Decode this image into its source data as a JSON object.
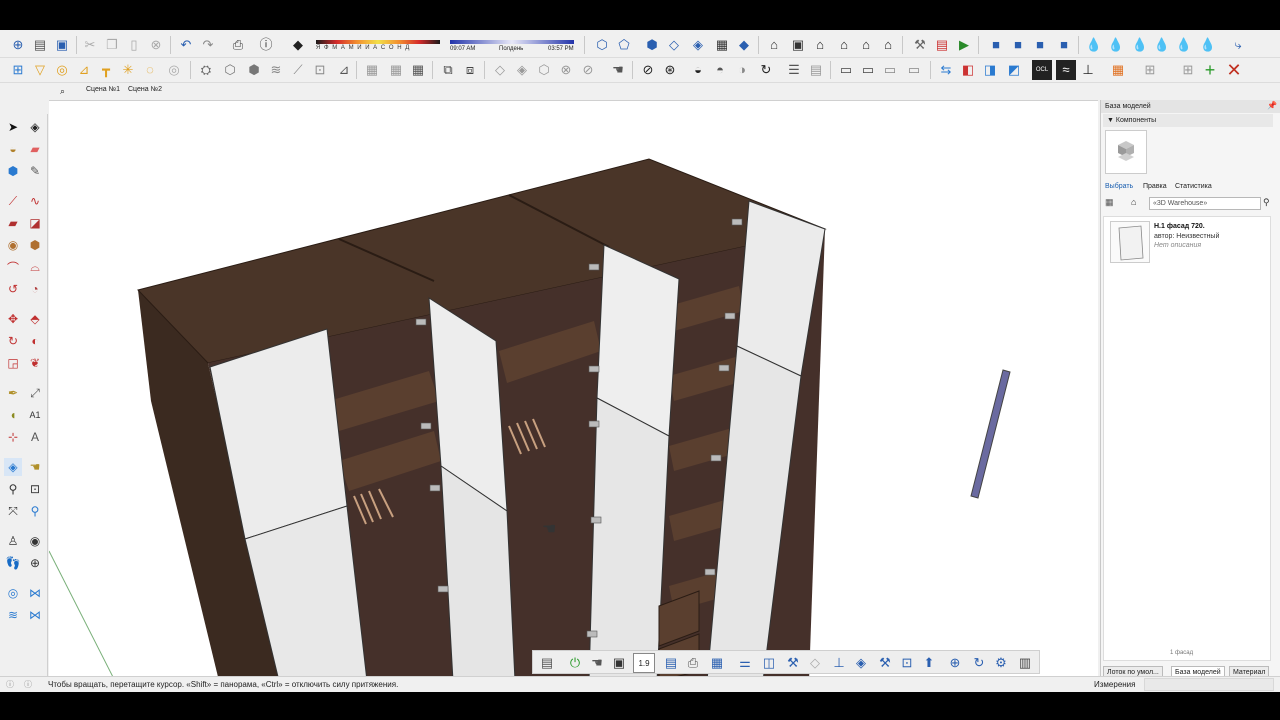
{
  "toolbar": {
    "shadow_months": "Я Ф М А М И И А С О Н Д",
    "time_start": "09:07 AM",
    "time_mid": "Полдень",
    "time_end": "03:57 PM"
  },
  "scene_tabs": [
    "Сцена №1",
    "Сцена №2"
  ],
  "panel": {
    "title": "База моделей",
    "components_label": "Компоненты",
    "tabs": [
      "Выбрать",
      "Правка",
      "Статистика"
    ],
    "search_placeholder": "«3D Warehouse»",
    "result": {
      "name": "Н.1 фасад 720.",
      "author": "автор: Неизвестный",
      "description": "Нет описания"
    },
    "count": "1 фасад",
    "bottom_tabs": [
      "Лоток по умол...",
      "База моделей",
      "Материал"
    ]
  },
  "bottom_toolbar": {
    "counter": "1.9"
  },
  "status": {
    "hint": "Чтобы вращать, перетащите курсор. «Shift» = панорама, «Ctrl» = отключить силу притяжения.",
    "measure_label": "Измерения"
  },
  "colors": {
    "wood_dark": "#3e2c22",
    "wood_mid": "#4a3528",
    "facade": "#ececec",
    "toolbar_bg": "#f0f0f0",
    "accent_blue": "#2a5fb0"
  },
  "icons": {
    "toolbar_top": [
      "new-file-icon",
      "open-folder-icon",
      "save-icon",
      "cut-icon",
      "copy-icon",
      "paste-icon",
      "erase-icon",
      "undo-icon",
      "redo-icon",
      "print-icon",
      "model-info-icon"
    ],
    "left_tools": [
      "select-icon",
      "orbit-icon",
      "paint-icon",
      "eraser-icon",
      "line-icon",
      "arc-icon",
      "rectangle-icon",
      "circle-icon",
      "move-icon",
      "rotate-icon",
      "scale-icon",
      "offset-icon",
      "tape-icon",
      "protractor-icon",
      "text-icon",
      "axes-icon",
      "pan-icon",
      "zoom-icon",
      "zoom-extents-icon",
      "walk-icon",
      "section-icon"
    ]
  }
}
